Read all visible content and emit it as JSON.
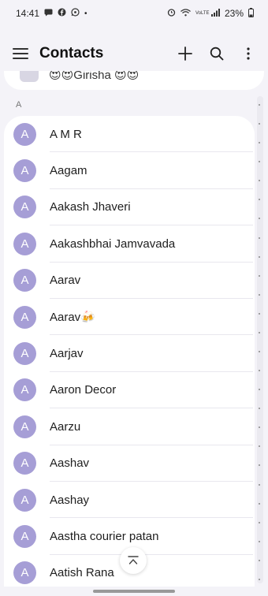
{
  "status": {
    "time": "14:41",
    "battery": "23%",
    "network": "VoLTE"
  },
  "header": {
    "title": "Contacts"
  },
  "prev_contact": {
    "text": "😍😍Girisha 😍😍"
  },
  "section": {
    "letter": "A"
  },
  "contacts": [
    {
      "initial": "A",
      "name": "A M R"
    },
    {
      "initial": "A",
      "name": "Aagam"
    },
    {
      "initial": "A",
      "name": "Aakash Jhaveri"
    },
    {
      "initial": "A",
      "name": "Aakashbhai Jamvavada"
    },
    {
      "initial": "A",
      "name": "Aarav"
    },
    {
      "initial": "A",
      "name": "Aarav🍻"
    },
    {
      "initial": "A",
      "name": "Aarjav"
    },
    {
      "initial": "A",
      "name": "Aaron Decor"
    },
    {
      "initial": "A",
      "name": "Aarzu"
    },
    {
      "initial": "A",
      "name": "Aashav"
    },
    {
      "initial": "A",
      "name": "Aashay"
    },
    {
      "initial": "A",
      "name": "Aastha courier patan"
    },
    {
      "initial": "A",
      "name": "Aatish Rana"
    }
  ],
  "colors": {
    "avatar": "#a69ed6",
    "background": "#f4f3f8",
    "card": "#ffffff"
  }
}
